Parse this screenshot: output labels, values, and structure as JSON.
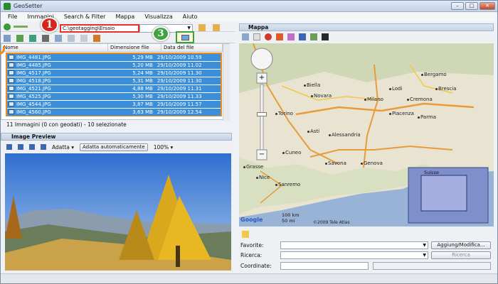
{
  "window": {
    "title": "GeoSetter"
  },
  "menu": [
    "File",
    "Immagini",
    "Search & Filter",
    "Mappa",
    "Visualizza",
    "Aiuto"
  ],
  "toolbar": {
    "path": "C:\\geotagging\\Ersaio"
  },
  "badges": {
    "one": "1",
    "three": "3"
  },
  "filelist": {
    "columns": [
      "Nome",
      "Dimensione file",
      "Data del file"
    ],
    "rows": [
      {
        "name": "IMG_4481.JPG",
        "size": "5,29 MB",
        "date": "29/10/2009 10.59"
      },
      {
        "name": "IMG_4485.JPG",
        "size": "5,20 MB",
        "date": "29/10/2009 11.02"
      },
      {
        "name": "IMG_4517.JPG",
        "size": "5,24 MB",
        "date": "29/10/2009 11.30"
      },
      {
        "name": "IMG_4518.JPG",
        "size": "5,31 MB",
        "date": "29/10/2009 11.30"
      },
      {
        "name": "IMG_4521.JPG",
        "size": "4,88 MB",
        "date": "29/10/2009 11.31"
      },
      {
        "name": "IMG_4525.JPG",
        "size": "5,30 MB",
        "date": "29/10/2009 11.33"
      },
      {
        "name": "IMG_4544.JPG",
        "size": "3,87 MB",
        "date": "29/10/2009 11.57"
      },
      {
        "name": "IMG_4560.JPG",
        "size": "3,63 MB",
        "date": "29/10/2009 12.54"
      }
    ],
    "status": "11 Immagini (0 con geodati) - 10 selezionate"
  },
  "preview": {
    "title": "Image Preview",
    "fit_label": "Adatta",
    "auto_fit_label": "Adatta automaticamente",
    "zoom": "100%"
  },
  "map": {
    "title": "Mappa",
    "cities": [
      {
        "name": "Bergamo"
      },
      {
        "name": "Brescia"
      },
      {
        "name": "Milano"
      },
      {
        "name": "Torino"
      },
      {
        "name": "Novara"
      },
      {
        "name": "Asti"
      },
      {
        "name": "Alessandria"
      },
      {
        "name": "Piacenza"
      },
      {
        "name": "Parma"
      },
      {
        "name": "Cremona"
      },
      {
        "name": "Genova"
      },
      {
        "name": "Nice"
      },
      {
        "name": "Cuneo"
      },
      {
        "name": "Savona"
      },
      {
        "name": "Grasse"
      },
      {
        "name": "Sanremo"
      },
      {
        "name": "Biella"
      },
      {
        "name": "Lodi"
      }
    ],
    "scale": [
      "100 km",
      "50 mi"
    ],
    "overview_label": "Suisse",
    "logo": "Google",
    "copyright": "©2009 Tele Atlas"
  },
  "bottom": {
    "favorite_label": "Favorite:",
    "search_label": "Ricerca:",
    "coord_label": "Coordinate:",
    "add_button": "Aggiung/Modifica...",
    "search_button": "Ricerca"
  }
}
